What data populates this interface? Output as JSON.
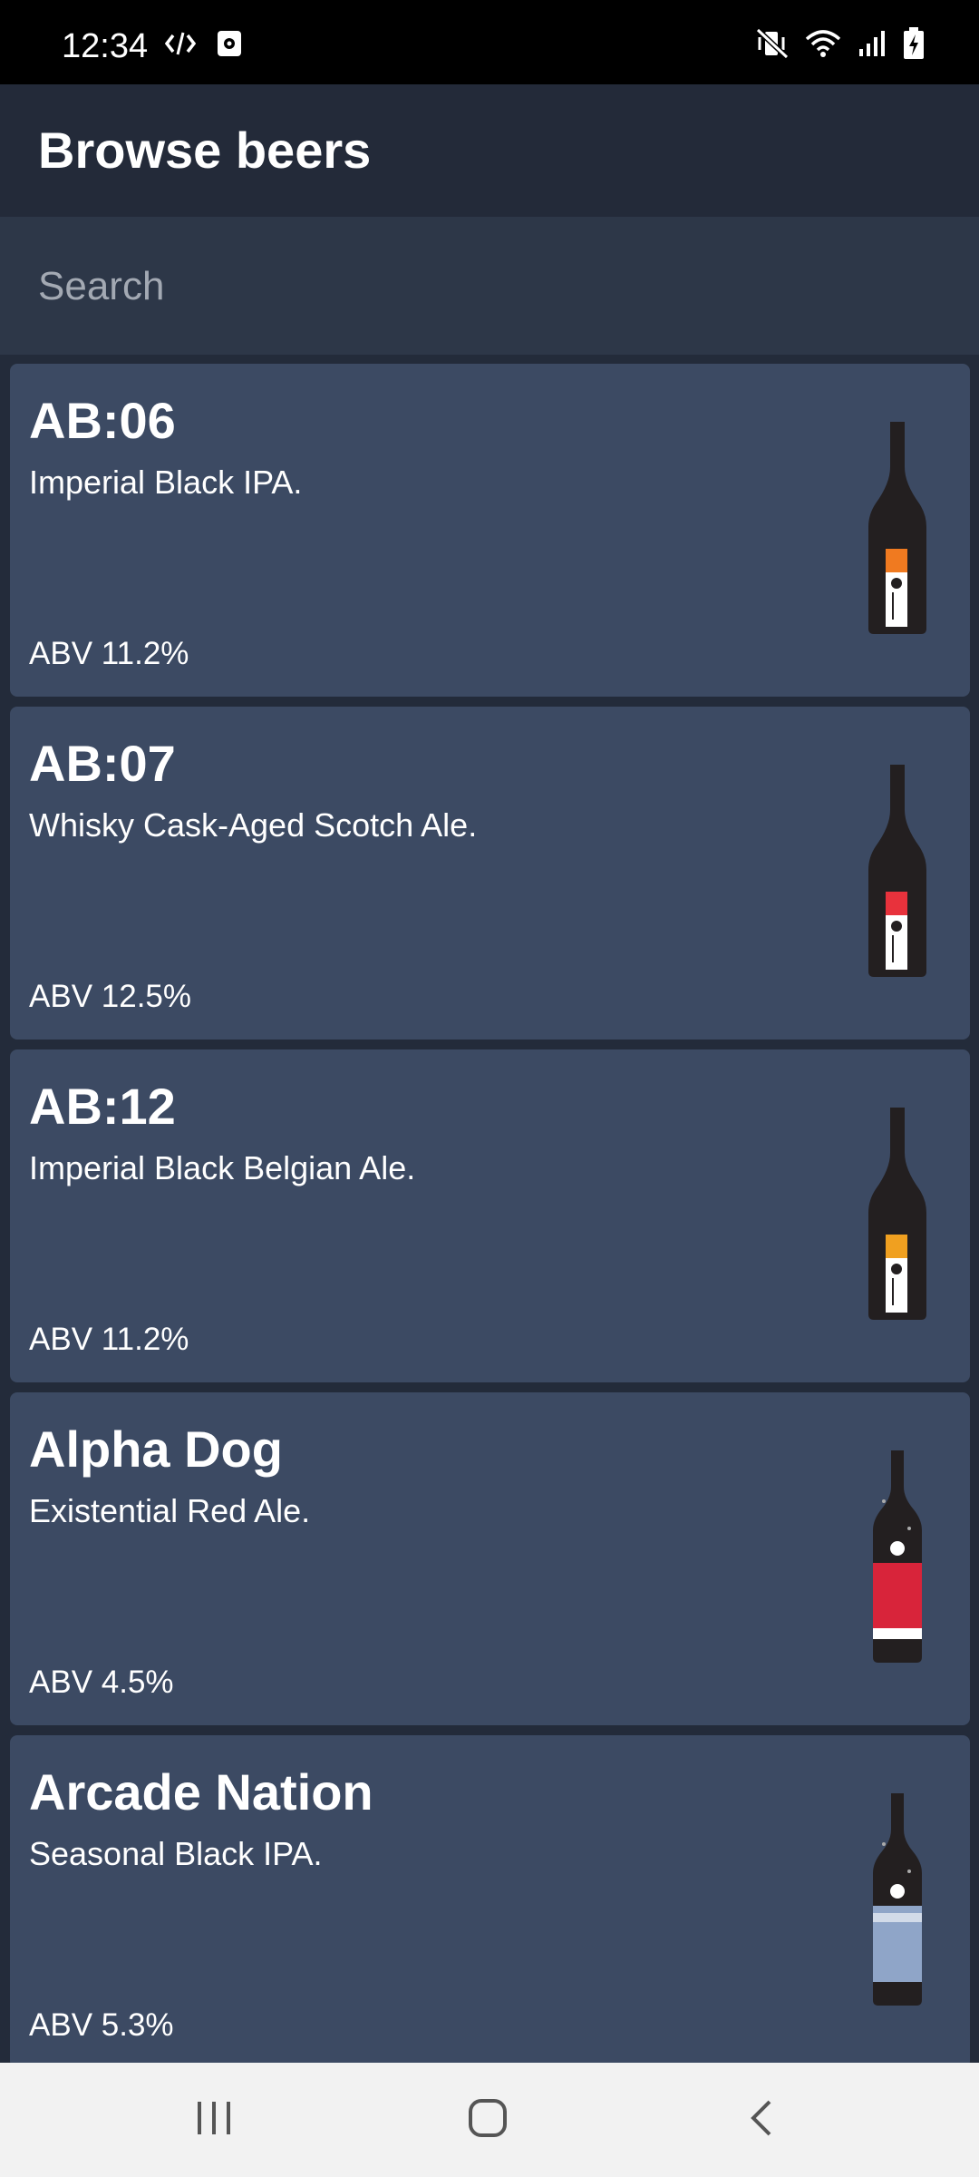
{
  "status_bar": {
    "time": "12:34",
    "left_icons": [
      "code-icon",
      "screen-record-icon"
    ],
    "right_icons": [
      "mute-vibrate-icon",
      "wifi-icon",
      "signal-icon",
      "battery-charging-icon"
    ]
  },
  "app_bar": {
    "title": "Browse beers"
  },
  "search": {
    "placeholder": "Search",
    "value": ""
  },
  "beers": [
    {
      "name": "AB:06",
      "tagline": "Imperial Black IPA.",
      "abv": "ABV 11.2%",
      "bottle_style": "tall-label-orange",
      "label_color": "#f07a20"
    },
    {
      "name": "AB:07",
      "tagline": "Whisky Cask-Aged Scotch Ale.",
      "abv": "ABV 12.5%",
      "bottle_style": "tall-label-red",
      "label_color": "#e8323c"
    },
    {
      "name": "AB:12",
      "tagline": "Imperial Black Belgian Ale.",
      "abv": "ABV 11.2%",
      "bottle_style": "tall-label-yellow",
      "label_color": "#f0a020"
    },
    {
      "name": "Alpha Dog",
      "tagline": "Existential Red Ale.",
      "abv": "ABV 4.5%",
      "bottle_style": "stubby-red-label",
      "label_color": "#d8243a"
    },
    {
      "name": "Arcade Nation",
      "tagline": "Seasonal Black IPA.",
      "abv": "ABV 5.3%",
      "bottle_style": "stubby-blue-label",
      "label_color": "#8fa5c8"
    }
  ],
  "nav_bar": {
    "icons": [
      "recent-apps-icon",
      "home-icon",
      "back-icon"
    ]
  },
  "colors": {
    "status_bar": "#000000",
    "app_bar": "#232a39",
    "search_bar": "#2d3748",
    "card": "#3c4a63",
    "list_background": "#232b3a",
    "nav_bar": "#f2f2f2"
  }
}
